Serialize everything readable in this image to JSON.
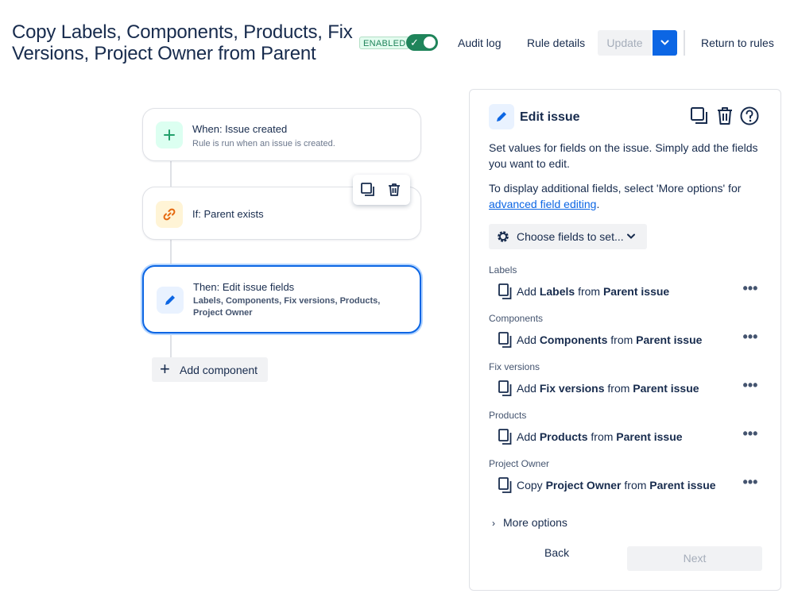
{
  "header": {
    "title": "Copy Labels, Components, Products, Fix Versions, Project Owner from Parent",
    "status": "ENABLED",
    "toggle_on": true,
    "audit_log": "Audit log",
    "rule_details": "Rule details",
    "update": "Update",
    "return_to_rules": "Return to rules"
  },
  "flow": {
    "trigger": {
      "title": "When: Issue created",
      "subtitle": "Rule is run when an issue is created.",
      "icon": "plus-icon",
      "color": "#22a06b"
    },
    "condition": {
      "title": "If: Parent exists",
      "icon": "link-icon",
      "color": "#e56910"
    },
    "action": {
      "title": "Then: Edit issue fields",
      "subtitle": "Labels, Components, Fix versions, Products, Project Owner",
      "icon": "pencil-icon",
      "color": "#0c66e4"
    },
    "add_component": "Add component"
  },
  "panel": {
    "title": "Edit issue",
    "description1": "Set values for fields on the issue. Simply add the fields you want to edit.",
    "description2_prefix": "To display additional fields, select 'More options' for",
    "description2_link": "advanced field editing",
    "description2_suffix": ".",
    "choose_fields": "Choose fields to set...",
    "fields": [
      {
        "label": "Labels",
        "verb": "Add",
        "field": "Labels",
        "from": "from",
        "source": "Parent issue"
      },
      {
        "label": "Components",
        "verb": "Add",
        "field": "Components",
        "from": "from",
        "source": "Parent issue"
      },
      {
        "label": "Fix versions",
        "verb": "Add",
        "field": "Fix versions",
        "from": "from",
        "source": "Parent issue"
      },
      {
        "label": "Products",
        "verb": "Add",
        "field": "Products",
        "from": "from",
        "source": "Parent issue"
      },
      {
        "label": "Project Owner",
        "verb": "Copy",
        "field": "Project Owner",
        "from": "from",
        "source": "Parent issue"
      }
    ],
    "more_options": "More options",
    "back": "Back",
    "next": "Next"
  }
}
